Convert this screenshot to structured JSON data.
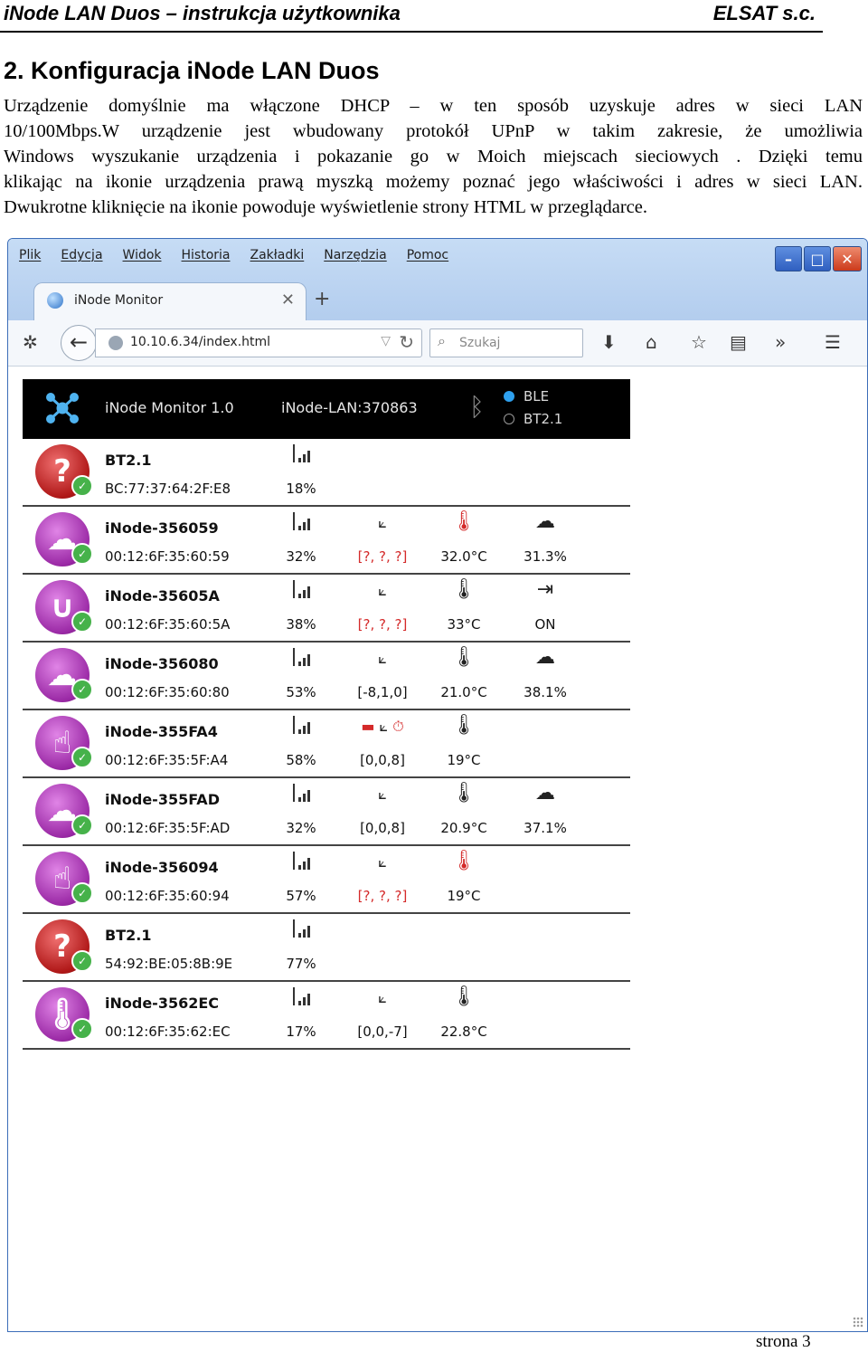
{
  "document": {
    "header_left": "iNode LAN Duos – instrukcja użytkownika",
    "header_right": "ELSAT s.c.",
    "section_title": "2. Konfiguracja iNode LAN Duos",
    "paragraph_lines": [
      "Urządzenie domyślnie ma włączone DHCP – w ten sposób uzyskuje adres w sieci LAN",
      "10/100Mbps.W urządzenie jest wbudowany protokół UPnP w takim zakresie, że umożliwia",
      "Windows wyszukanie urządzenia i pokazanie go w Moich miejscach sieciowych . Dzięki temu",
      "klikając na ikonie urządzenia prawą myszką możemy poznać jego właściwości i adres w sieci LAN.",
      "Dwukrotne kliknięcie na ikonie powoduje wyświetlenie strony HTML w przeglądarce."
    ],
    "page_number": "strona 3"
  },
  "browser": {
    "menu": [
      "Plik",
      "Edycja",
      "Widok",
      "Historia",
      "Zakładki",
      "Narzędzia",
      "Pomoc"
    ],
    "window_buttons": [
      "minimize",
      "maximize",
      "close"
    ],
    "tab_title": "iNode Monitor",
    "url": "10.10.6.34/index.html",
    "search_placeholder": "Szukaj",
    "toolbar_icons": [
      "download-icon",
      "home-icon",
      "bookmark-star-icon",
      "reading-list-icon",
      "overflow-icon",
      "menu-icon"
    ]
  },
  "app": {
    "title": "iNode Monitor 1.0",
    "device": "iNode-LAN:370863",
    "radio_options": [
      "BLE",
      "BT2.1"
    ],
    "radio_selected": "BLE",
    "colors": {
      "alert_red": "#d42a2a",
      "purple": "#9b2aa6",
      "red_icon": "#b01818",
      "check_green": "#46b24a"
    }
  },
  "devices": [
    {
      "name": "BT2.1",
      "mac": "BC:77:37:64:2F:E8",
      "icon": "question-icon",
      "color": "red",
      "signal": "18%",
      "acc": "",
      "temp": "",
      "extra": "",
      "extra_icon": ""
    },
    {
      "name": "iNode-356059",
      "mac": "00:12:6F:35:60:59",
      "icon": "weather-icon",
      "color": "purple",
      "signal": "32%",
      "acc": "[?, ?, ?]",
      "acc_red": true,
      "temp": "32.0°C",
      "temp_red": true,
      "extra": "31.3%",
      "extra_icon": "humidity-cloud-icon"
    },
    {
      "name": "iNode-35605A",
      "mac": "00:12:6F:35:60:5A",
      "icon": "magnet-icon",
      "color": "purple",
      "signal": "38%",
      "acc": "[?, ?, ?]",
      "acc_red": true,
      "temp": "33°C",
      "extra": "ON",
      "extra_icon": "input-icon"
    },
    {
      "name": "iNode-356080",
      "mac": "00:12:6F:35:60:80",
      "icon": "weather-icon",
      "color": "purple",
      "signal": "53%",
      "acc": "[-8,1,0]",
      "temp": "21.0°C",
      "extra": "38.1%",
      "extra_icon": "humidity-cloud-icon"
    },
    {
      "name": "iNode-355FA4",
      "mac": "00:12:6F:35:5F:A4",
      "icon": "touch-icon",
      "color": "purple",
      "signal": "58%",
      "acc": "[0,0,8]",
      "acc_alert": true,
      "temp": "19°C",
      "extra": "",
      "extra_icon": ""
    },
    {
      "name": "iNode-355FAD",
      "mac": "00:12:6F:35:5F:AD",
      "icon": "weather-icon",
      "color": "purple",
      "signal": "32%",
      "acc": "[0,0,8]",
      "temp": "20.9°C",
      "extra": "37.1%",
      "extra_icon": "humidity-cloud-icon"
    },
    {
      "name": "iNode-356094",
      "mac": "00:12:6F:35:60:94",
      "icon": "touch-icon",
      "color": "purple",
      "signal": "57%",
      "acc": "[?, ?, ?]",
      "acc_red": true,
      "temp": "19°C",
      "temp_red": true,
      "extra": "",
      "extra_icon": ""
    },
    {
      "name": "BT2.1",
      "mac": "54:92:BE:05:8B:9E",
      "icon": "question-icon",
      "color": "red",
      "signal": "77%",
      "acc": "",
      "temp": "",
      "extra": "",
      "extra_icon": ""
    },
    {
      "name": "iNode-3562EC",
      "mac": "00:12:6F:35:62:EC",
      "icon": "thermometer-icon",
      "color": "purple",
      "signal": "17%",
      "acc": "[0,0,-7]",
      "temp": "22.8°C",
      "extra": "",
      "extra_icon": ""
    }
  ]
}
